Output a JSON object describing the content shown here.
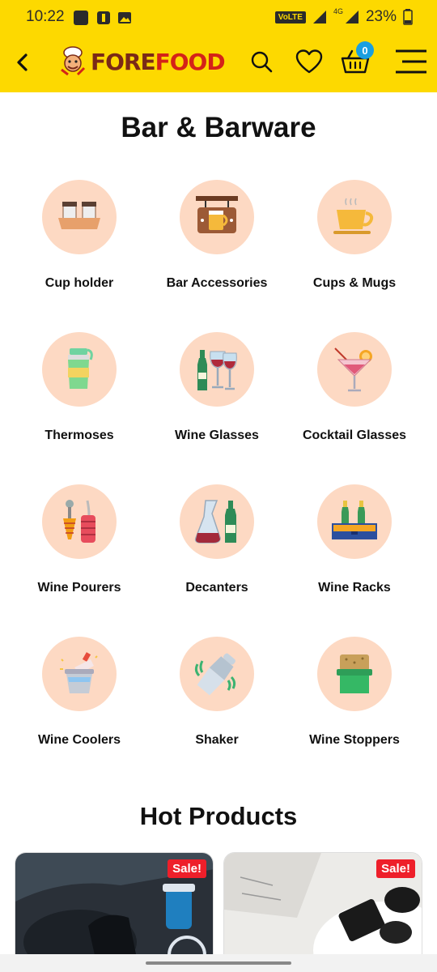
{
  "status": {
    "time": "10:22",
    "volte": "VoLTE",
    "network": "4G",
    "battery": "23%"
  },
  "header": {
    "brand_part1": "FORE",
    "brand_part2": "FOOD",
    "cart_count": "0",
    "icons": [
      "back-arrow-icon",
      "search-icon",
      "heart-icon",
      "basket-icon",
      "menu-icon"
    ],
    "colors": {
      "background": "#FDD900",
      "brand_dark": "#7a2a17",
      "brand_red": "#d42318",
      "badge": "#1a9fe0"
    }
  },
  "page_title": "Bar & Barware",
  "categories": [
    {
      "label": "Cup holder",
      "icon": "cup-holder-icon"
    },
    {
      "label": "Bar Accessories",
      "icon": "bar-sign-icon"
    },
    {
      "label": "Cups & Mugs",
      "icon": "mug-icon"
    },
    {
      "label": "Thermoses",
      "icon": "thermos-icon"
    },
    {
      "label": "Wine Glasses",
      "icon": "wine-glasses-icon"
    },
    {
      "label": "Cocktail Glasses",
      "icon": "cocktail-icon"
    },
    {
      "label": "Wine Pourers",
      "icon": "wine-pourer-icon"
    },
    {
      "label": "Decanters",
      "icon": "decanter-icon"
    },
    {
      "label": "Wine Racks",
      "icon": "wine-rack-icon"
    },
    {
      "label": "Wine Coolers",
      "icon": "wine-cooler-icon"
    },
    {
      "label": "Shaker",
      "icon": "shaker-icon"
    },
    {
      "label": "Wine Stoppers",
      "icon": "wine-stopper-icon"
    }
  ],
  "hot_products": {
    "title": "Hot Products",
    "items": [
      {
        "badge": "Sale!"
      },
      {
        "badge": "Sale!"
      }
    ]
  }
}
